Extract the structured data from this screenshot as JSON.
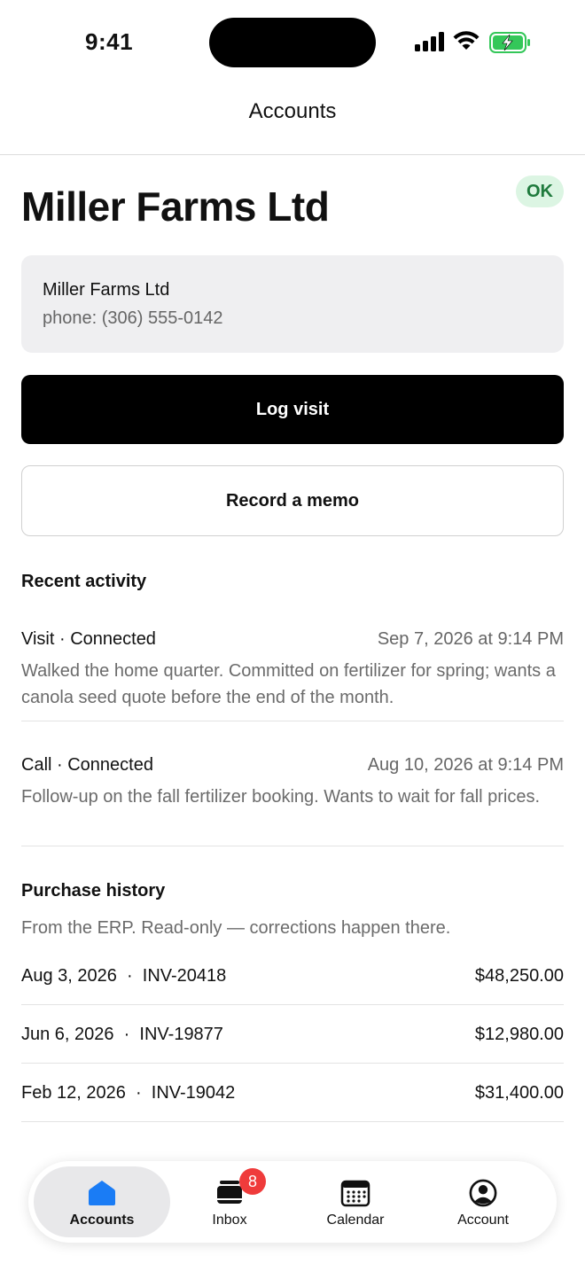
{
  "status_bar": {
    "time": "9:41",
    "colors": {
      "battery": "#34c759"
    }
  },
  "nav": {
    "title": "Accounts"
  },
  "account": {
    "name": "Miller Farms Ltd",
    "status": "OK",
    "contact_name": "Miller Farms Ltd",
    "phone": "phone: (306) 555-0142"
  },
  "actions": {
    "log_visit": "Log visit",
    "record_memo": "Record a memo"
  },
  "recent_activity": {
    "title": "Recent activity",
    "items": [
      {
        "type": "Visit · Connected",
        "date": "Sep 7, 2026 at 9:14 PM",
        "body": "Walked the home quarter. Committed on fertilizer for spring; wants a canola seed quote before the end of the month."
      },
      {
        "type": "Call · Connected",
        "date": "Aug 10, 2026 at 9:14 PM",
        "body": "Follow-up on the fall fertilizer booking. Wants to wait for fall prices."
      }
    ]
  },
  "purchase_history": {
    "title": "Purchase history",
    "subtitle": "From the ERP. Read-only — corrections happen there.",
    "rows": [
      {
        "left": "Aug 3, 2026  ·  INV-20418",
        "amount": "$48,250.00"
      },
      {
        "left": "Jun 6, 2026  ·  INV-19877",
        "amount": "$12,980.00"
      },
      {
        "left": "Feb 12, 2026  ·  INV-19042",
        "amount": "$31,400.00"
      }
    ]
  },
  "tabbar": {
    "accent": "#1a7cf5",
    "items": [
      {
        "label": "Accounts",
        "icon": "house-icon"
      },
      {
        "label": "Inbox",
        "icon": "inbox-icon",
        "badge": "8"
      },
      {
        "label": "Calendar",
        "icon": "calendar-icon"
      },
      {
        "label": "Account",
        "icon": "person-circle-icon"
      }
    ]
  }
}
